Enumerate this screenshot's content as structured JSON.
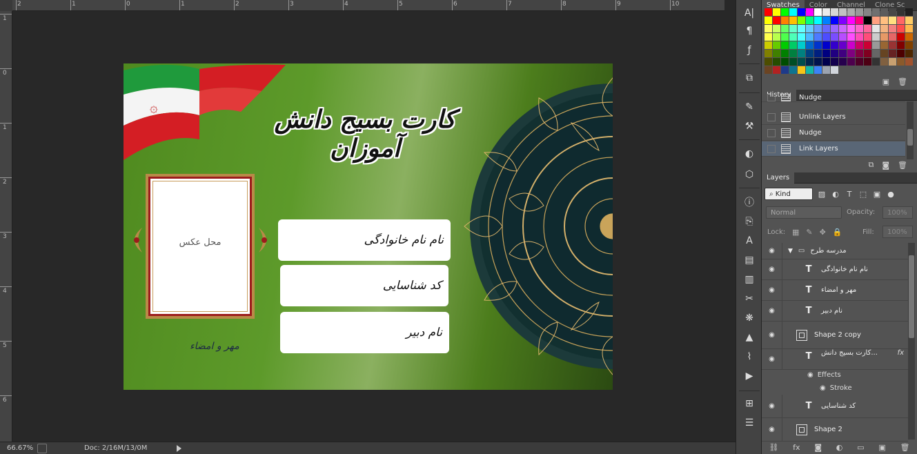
{
  "ruler": {
    "top_labels": [
      "2",
      "1",
      "0",
      "1",
      "2",
      "3",
      "4",
      "5",
      "6",
      "7",
      "8",
      "9",
      "10"
    ],
    "left_labels": [
      "1",
      "0",
      "1",
      "2",
      "3",
      "4",
      "5",
      "6"
    ]
  },
  "card": {
    "title": "کارت بسیج دانش آموزان",
    "photo_label": "محل عکس",
    "field_family": "نام نام خانوادگی",
    "field_code": "کد شناسایی",
    "field_teacher": "نام دبیر",
    "signature": "مهر و امضاء"
  },
  "status": {
    "zoom": "66.67%",
    "doc_size": "Doc: 2/16M/13/0M"
  },
  "swatches_panel": {
    "tabs": [
      "Swatches",
      "Color",
      "Channel",
      "Clone Sc"
    ],
    "colors": [
      "#ff0000",
      "#ffff00",
      "#00ff00",
      "#00ffff",
      "#0000ff",
      "#ff00ff",
      "#ffffff",
      "#ebebeb",
      "#d6d6d6",
      "#c2c2c2",
      "#adadad",
      "#999999",
      "#858585",
      "#707070",
      "#5c5c5c",
      "#474747",
      "#333333",
      "#1f1f1f",
      "#ffff00",
      "#ff0000",
      "#ff8000",
      "#ffbf00",
      "#7fff00",
      "#00ff80",
      "#00ffff",
      "#0080ff",
      "#0000ff",
      "#8000ff",
      "#ff00ff",
      "#ff0080",
      "#000000",
      "#ff9f80",
      "#ffbf80",
      "#ffdf80",
      "#ff6666",
      "#ffcc66",
      "#ffff66",
      "#ccff66",
      "#66ff66",
      "#66ffcc",
      "#66ffff",
      "#66ccff",
      "#6699ff",
      "#6666ff",
      "#9966ff",
      "#cc66ff",
      "#ff66ff",
      "#ff66cc",
      "#ff6699",
      "#e6e6e6",
      "#f2b380",
      "#f28080",
      "#ff4d4d",
      "#ffb84d",
      "#ffff4d",
      "#b8ff4d",
      "#4dff4d",
      "#4dffb8",
      "#4dffff",
      "#4db8ff",
      "#4d7aff",
      "#4d4dff",
      "#7a4dff",
      "#b84dff",
      "#ff4dff",
      "#ff4db8",
      "#ff4d7a",
      "#cccccc",
      "#e69966",
      "#e66666",
      "#cc0000",
      "#cc6600",
      "#cccc00",
      "#66cc00",
      "#00cc00",
      "#00cc66",
      "#00cccc",
      "#0066cc",
      "#0033cc",
      "#0000cc",
      "#3300cc",
      "#6600cc",
      "#cc00cc",
      "#cc0066",
      "#cc0033",
      "#999999",
      "#996633",
      "#993333",
      "#800000",
      "#804000",
      "#808000",
      "#408000",
      "#008000",
      "#008040",
      "#008080",
      "#004080",
      "#002080",
      "#000080",
      "#200080",
      "#400080",
      "#800080",
      "#800040",
      "#800020",
      "#666666",
      "#664422",
      "#662222",
      "#4d0000",
      "#4d2600",
      "#4d4d00",
      "#264d00",
      "#004d00",
      "#004d26",
      "#004d4d",
      "#00264d",
      "#00134d",
      "#00004d",
      "#13004d",
      "#26004d",
      "#4d004d",
      "#4d0026",
      "#4d0013",
      "#333333",
      "#806040",
      "#c8a070",
      "#8b5a2b",
      "#a0522d",
      "#6b4423",
      "#b22222",
      "#1e3a8a",
      "#0e7490",
      "#f5c518",
      "#14b8a6",
      "#3b82f6",
      "#9ca3af",
      "#d1d5db"
    ]
  },
  "history_panel": {
    "tab": "History",
    "items": [
      "Nudge",
      "Unlink Layers",
      "Nudge",
      "Link Layers"
    ]
  },
  "layers_panel": {
    "tab": "Layers",
    "kind": "Kind",
    "blend_mode": "Normal",
    "opacity_label": "Opacity:",
    "opacity_value": "100%",
    "lock_label": "Lock:",
    "fill_label": "Fill:",
    "fill_value": "100%",
    "group_name": "مدرسه طرح",
    "layers": [
      {
        "name": "نام نام خانوادگی",
        "kind": "text"
      },
      {
        "name": "مهر و امضاء",
        "kind": "text"
      },
      {
        "name": "نام دبیر",
        "kind": "text"
      },
      {
        "name": "Shape 2 copy",
        "kind": "shape"
      },
      {
        "name": "کارت بسیج دانش...",
        "kind": "text"
      },
      {
        "name": "کد شناسایی",
        "kind": "text"
      },
      {
        "name": "Shape 2",
        "kind": "shape"
      }
    ],
    "effects_label": "Effects",
    "stroke_label": "Stroke",
    "fx_label": "fx"
  }
}
